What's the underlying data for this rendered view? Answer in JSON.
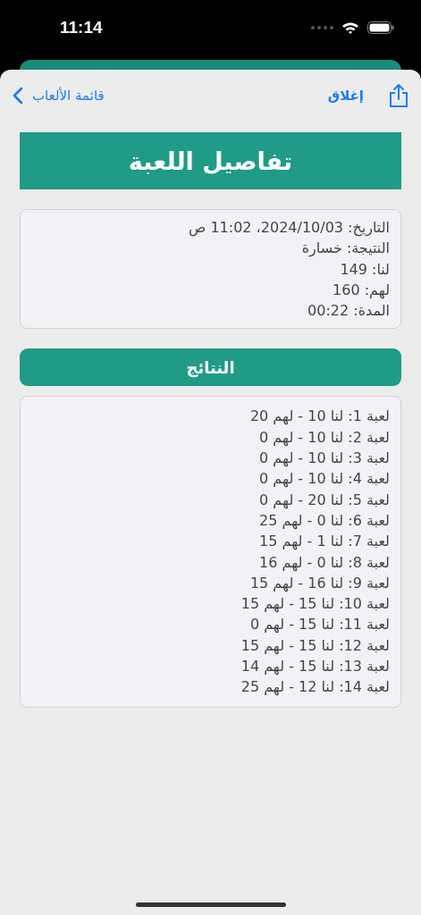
{
  "status_bar": {
    "time": "11:14"
  },
  "nav": {
    "back": "قائمة الألعاب",
    "close": "إغلاق"
  },
  "title": "تفاصيل اللعبة",
  "summary": [
    "التاريخ: 2024/10/03، 11:02 ص",
    "النتيجة: خسارة",
    "لنا: 149",
    "لهم: 160",
    "المدة: 00:22"
  ],
  "results_button": "النتائج",
  "results": [
    "لعبة 1: لنا 10 - لهم 20",
    "لعبة 2: لنا 10 - لهم 0",
    "لعبة 3: لنا 10 - لهم 0",
    "لعبة 4: لنا 10 - لهم 0",
    "لعبة 5: لنا 20 - لهم 0",
    "لعبة 6: لنا 0 - لهم 25",
    "لعبة 7: لنا 1 - لهم 15",
    "لعبة 8: لنا 0 - لهم 16",
    "لعبة 9: لنا 16 - لهم 15",
    "لعبة 10: لنا 15 - لهم 15",
    "لعبة 11: لنا 15 - لهم 0",
    "لعبة 12: لنا 15 - لهم 15",
    "لعبة 13: لنا 15 - لهم 14",
    "لعبة 14: لنا 12 - لهم 25"
  ]
}
